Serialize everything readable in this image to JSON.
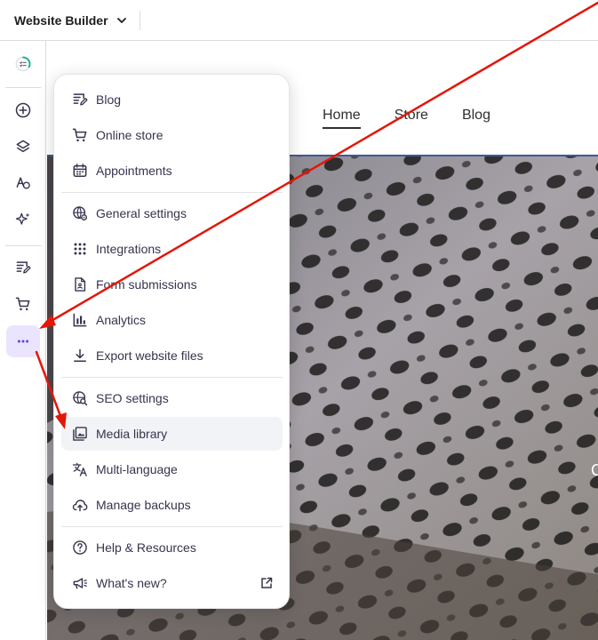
{
  "topbar": {
    "app_title": "Website Builder"
  },
  "site": {
    "nav": [
      "Home",
      "Store",
      "Blog"
    ],
    "hero_partial_text": "C"
  },
  "menu": {
    "group1": [
      {
        "label": "Blog",
        "icon": "blog-icon"
      },
      {
        "label": "Online store",
        "icon": "cart-icon"
      },
      {
        "label": "Appointments",
        "icon": "calendar-icon"
      }
    ],
    "group2": [
      {
        "label": "General settings",
        "icon": "globe-gear-icon"
      },
      {
        "label": "Integrations",
        "icon": "grid-dots-icon"
      },
      {
        "label": "Form submissions",
        "icon": "document-icon"
      },
      {
        "label": "Analytics",
        "icon": "bar-chart-icon"
      },
      {
        "label": "Export website files",
        "icon": "download-icon"
      }
    ],
    "group3": [
      {
        "label": "SEO settings",
        "icon": "seo-search-icon"
      },
      {
        "label": "Media library",
        "icon": "image-library-icon"
      },
      {
        "label": "Multi-language",
        "icon": "translate-icon"
      },
      {
        "label": "Manage backups",
        "icon": "cloud-upload-icon"
      }
    ],
    "group4": [
      {
        "label": "Help & Resources",
        "icon": "help-icon"
      },
      {
        "label": "What's new?",
        "icon": "megaphone-icon"
      }
    ],
    "highlighted": "Media library"
  },
  "colors": {
    "accent": "#673de6",
    "active_bg": "#ebe4ff",
    "annotation_arrow": "#e3170a"
  }
}
